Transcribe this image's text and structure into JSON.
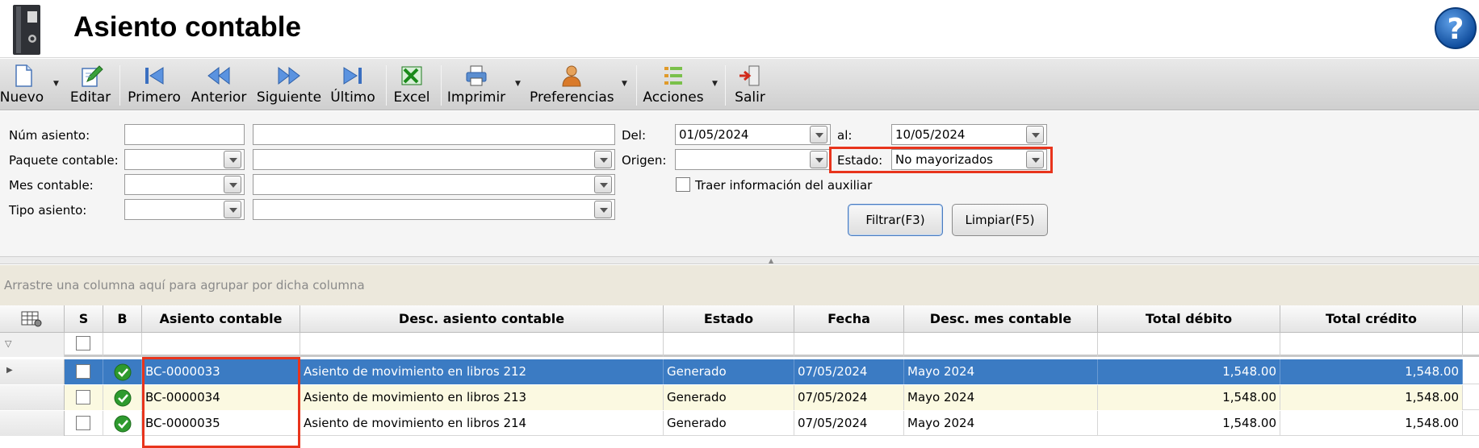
{
  "header": {
    "title": "Asiento contable",
    "help_icon": "question-mark-icon"
  },
  "toolbar": {
    "nuevo": "Nuevo",
    "editar": "Editar",
    "primero": "Primero",
    "anterior": "Anterior",
    "siguiente": "Siguiente",
    "ultimo": "Último",
    "excel": "Excel",
    "imprimir": "Imprimir",
    "preferencias": "Preferencias",
    "acciones": "Acciones",
    "salir": "Salir"
  },
  "filters": {
    "num_asiento_label": "Núm asiento:",
    "paquete_label": "Paquete contable:",
    "mes_label": "Mes contable:",
    "tipo_label": "Tipo asiento:",
    "del_label": "Del:",
    "del_value": "01/05/2024",
    "al_label": "al:",
    "al_value": "10/05/2024",
    "origen_label": "Origen:",
    "estado_label": "Estado:",
    "estado_value": "No mayorizados",
    "auxiliar_label": "Traer información del auxiliar",
    "filtrar_button": "Filtrar(F3)",
    "limpiar_button": "Limpiar(F5)"
  },
  "grid": {
    "group_hint": "Arrastre una columna aquí para agrupar por dicha columna",
    "columns": {
      "s": "S",
      "b": "B",
      "asiento": "Asiento contable",
      "desc": "Desc. asiento contable",
      "estado": "Estado",
      "fecha": "Fecha",
      "mes": "Desc. mes contable",
      "debito": "Total débito",
      "credito": "Total crédito"
    },
    "rows": [
      {
        "asiento": "BC-0000033",
        "desc": "Asiento de movimiento en libros 212",
        "estado": "Generado",
        "fecha": "07/05/2024",
        "mes": "Mayo 2024",
        "debito": "1,548.00",
        "credito": "1,548.00"
      },
      {
        "asiento": "BC-0000034",
        "desc": "Asiento de movimiento en libros 213",
        "estado": "Generado",
        "fecha": "07/05/2024",
        "mes": "Mayo 2024",
        "debito": "1,548.00",
        "credito": "1,548.00"
      },
      {
        "asiento": "BC-0000035",
        "desc": "Asiento de movimiento en libros 214",
        "estado": "Generado",
        "fecha": "07/05/2024",
        "mes": "Mayo 2024",
        "debito": "1,548.00",
        "credito": "1,548.00"
      }
    ]
  },
  "colors": {
    "selected_row": "#3b7bc3",
    "alt_row": "#fbf9e1",
    "highlight": "#e8341c",
    "status_ok": "#2e9a2e"
  }
}
